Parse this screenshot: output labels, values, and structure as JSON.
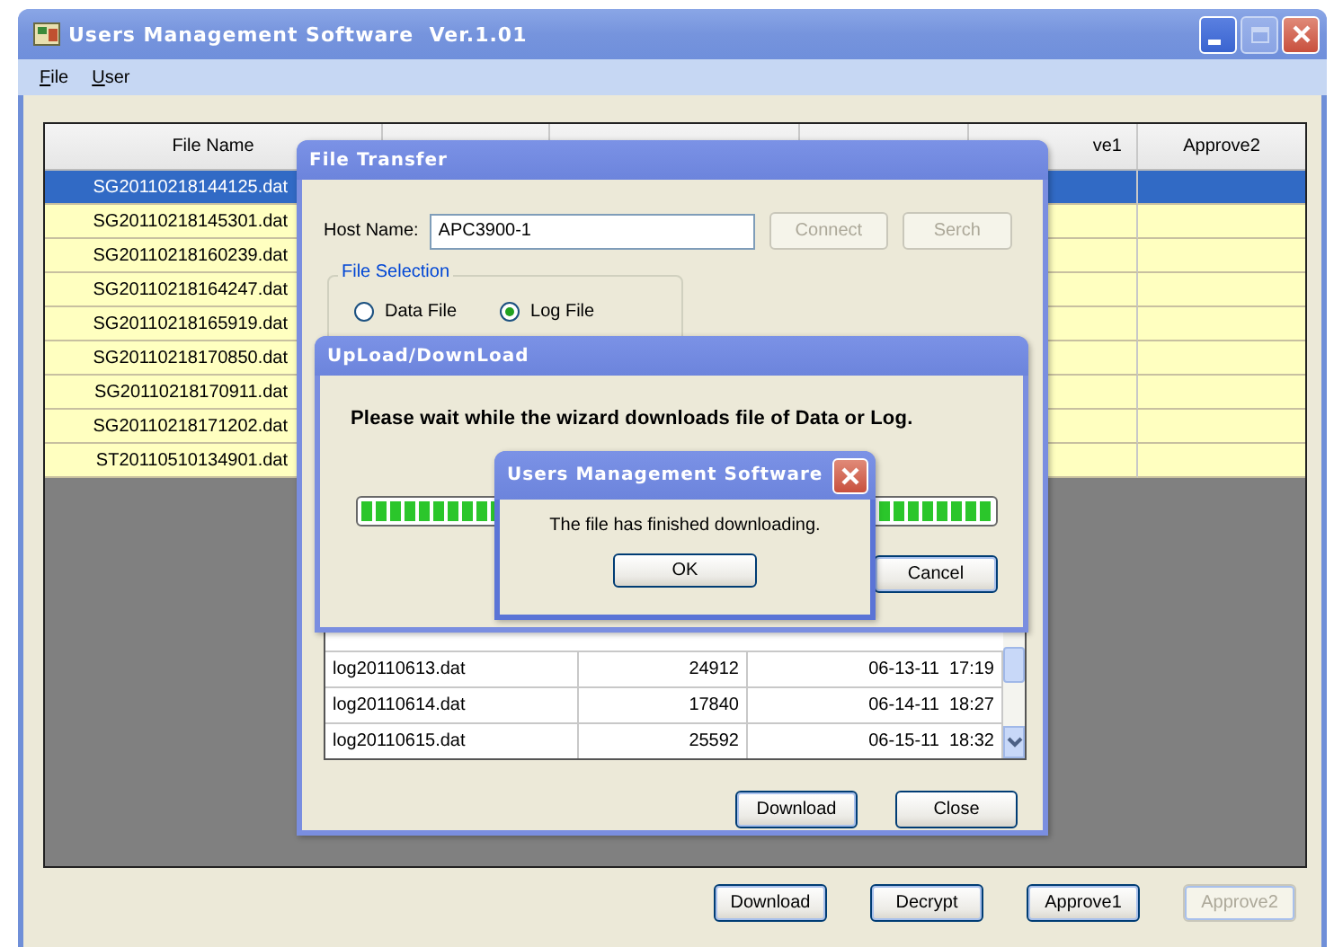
{
  "window": {
    "title": "Users Management Software  Ver.1.01"
  },
  "menu": [
    {
      "label": "File"
    },
    {
      "label": "User"
    }
  ],
  "table": {
    "columns": [
      "File Name",
      "ve1",
      "Approve2"
    ],
    "rows": [
      {
        "file_name": "SG20110218144125.dat",
        "selected": true
      },
      {
        "file_name": "SG20110218145301.dat",
        "selected": false
      },
      {
        "file_name": "SG20110218160239.dat",
        "selected": false
      },
      {
        "file_name": "SG20110218164247.dat",
        "selected": false
      },
      {
        "file_name": "SG20110218165919.dat",
        "selected": false
      },
      {
        "file_name": "SG20110218170850.dat",
        "selected": false
      },
      {
        "file_name": "SG20110218170911.dat",
        "selected": false
      },
      {
        "file_name": "SG20110218171202.dat",
        "selected": false
      },
      {
        "file_name": "ST20110510134901.dat",
        "selected": false
      }
    ]
  },
  "buttons": [
    {
      "label": "Download",
      "disabled": false
    },
    {
      "label": "Decrypt",
      "disabled": false
    },
    {
      "label": "Approve1",
      "disabled": false
    },
    {
      "label": "Approve2",
      "disabled": true
    }
  ],
  "file_transfer": {
    "title": "File Transfer",
    "host_label": "Host Name:",
    "host_value": "APC3900-1",
    "host_buttons": [
      {
        "label": "Connect",
        "disabled": true
      },
      {
        "label": "Serch",
        "disabled": true
      }
    ],
    "file_selection": {
      "title": "File Selection",
      "options": [
        {
          "label": "Data File",
          "selected": false
        },
        {
          "label": "Log File",
          "selected": true
        }
      ]
    },
    "files": [
      {
        "name": "log20110613.dat",
        "size": "24912",
        "date": "06-13-11  17:19"
      },
      {
        "name": "log20110614.dat",
        "size": "17840",
        "date": "06-14-11  18:27"
      },
      {
        "name": "log20110615.dat",
        "size": "25592",
        "date": "06-15-11  18:32"
      }
    ],
    "buttons": [
      {
        "label": "Download",
        "disabled": false
      },
      {
        "label": "Close",
        "disabled": false
      }
    ]
  },
  "progress_dialog": {
    "title": "UpLoad/DownLoad",
    "message": "Please wait while the wizard downloads file of Data or Log.",
    "level": 1,
    "buttons": [
      {
        "label": "Cancel",
        "disabled": false
      }
    ]
  },
  "message_box": {
    "title": "Users Management Software",
    "message": "The file has finished downloading.",
    "button": "OK"
  }
}
